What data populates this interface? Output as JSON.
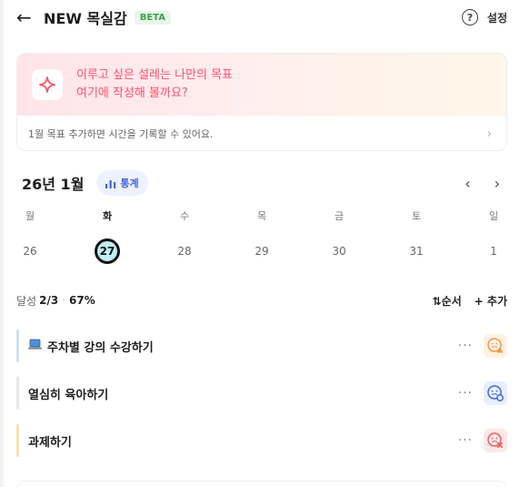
{
  "header": {
    "title": "NEW 목실감",
    "badge": "BETA",
    "help_icon": "question-circle-icon",
    "settings_label": "설정"
  },
  "goal_card": {
    "icon": "sparkle-icon",
    "line1": "이루고 싶은 설레는 나만의 목표",
    "line2": "여기에 작성해 볼까요?",
    "footer": "1월 목표  추가하면 시간을 기록할 수 있어요.",
    "accent": "#ff4f6d"
  },
  "calendar": {
    "month_label": "26년 1월",
    "stats_label": "통계",
    "weekdays": [
      "월",
      "화",
      "수",
      "목",
      "금",
      "토",
      "일"
    ],
    "dates": [
      "26",
      "27",
      "28",
      "29",
      "30",
      "31",
      "1"
    ],
    "today_index": 1
  },
  "progress": {
    "label": "달성",
    "count": "2/3",
    "separator": "·",
    "percent": "67%",
    "order_label": "순서",
    "add_label": "추가"
  },
  "todos": [
    {
      "title": "주차별 강의 수강하기",
      "icon": "laptop-icon",
      "bar_color": "#cfe0f3",
      "face_color": "#f2994a",
      "face_bg": "#fff1e3",
      "face_icon": "face-warning-icon"
    },
    {
      "title": "열심히 육아하기",
      "icon": "",
      "bar_color": "#e6e8ec",
      "face_color": "#3f67e0",
      "face_bg": "#e8eeff",
      "face_icon": "face-check-icon"
    },
    {
      "title": "과제하기",
      "icon": "",
      "bar_color": "#f7e3b5",
      "face_color": "#ef5b5b",
      "face_bg": "#fde8e8",
      "face_icon": "face-x-icon"
    }
  ],
  "more_label": "···"
}
